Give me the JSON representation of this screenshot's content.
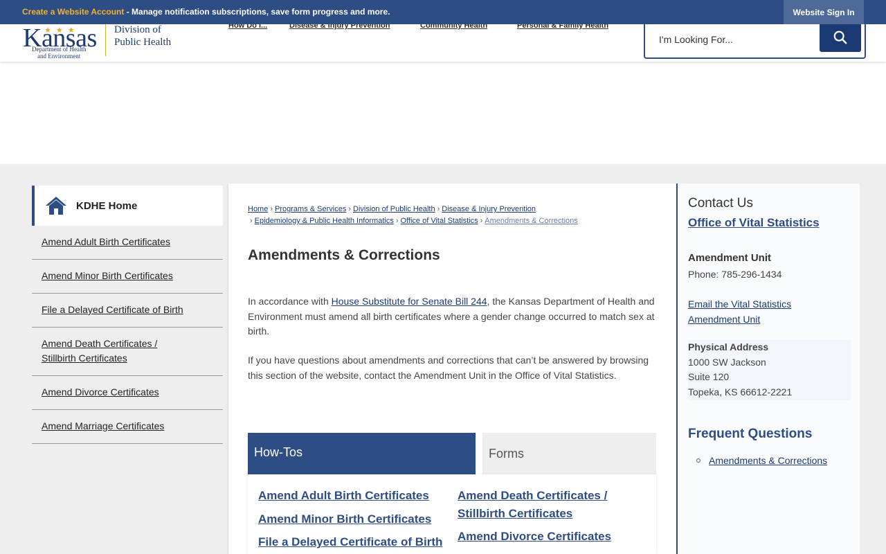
{
  "topbar": {
    "create_label": "Create a Website Account",
    "message": " - Manage notification subscriptions, save form progress and more.",
    "signin_label": "Website Sign In"
  },
  "logo": {
    "kansas": "Kansas",
    "dept_line1": "Department of Health",
    "dept_line2": "and Environment",
    "division_line1": "Division of",
    "division_line2": "Public Health"
  },
  "nav": {
    "items": [
      "How Do I...",
      "Disease & Injury Prevention",
      "Community Health",
      "Personal & Family Health"
    ]
  },
  "search": {
    "placeholder": "I'm Looking For..."
  },
  "sidebar": {
    "home_label": "KDHE Home",
    "items": [
      "Amend Adult Birth Certificates",
      "Amend Minor Birth Certificates",
      "File a Delayed Certificate of Birth",
      "Amend Death Certificates / Stillbirth Certificates",
      "Amend Divorce Certificates",
      "Amend Marriage Certificates"
    ]
  },
  "breadcrumb": {
    "items": [
      "Home",
      "Programs & Services",
      "Division of Public Health",
      "Disease & Injury Prevention",
      "Epidemiology & Public Health Informatics",
      "Office of Vital Statistics"
    ],
    "current": "Amendments & Corrections"
  },
  "main": {
    "title": "Amendments & Corrections",
    "para1_prefix": "In accordance with ",
    "para1_link": "House Substitute for Senate Bill 244",
    "para1_suffix": ", the Kansas Department of Health and Environment must amend all birth certificates where a gender change occurred to match sex at birth.",
    "para2": "If you have questions about amendments and corrections that can’t be answered by browsing this section of the website, contact the Amendment Unit in the Office of Vital Statistics."
  },
  "tabs": {
    "active_label": "How-Tos",
    "inactive_label": "Forms",
    "left_links": [
      "Amend Adult Birth Certificates",
      "Amend Minor Birth Certificates",
      "File a Delayed Certificate of Birth"
    ],
    "right_links": [
      "Amend Death Certificates / Stillbirth Certificates",
      "Amend Divorce Certificates"
    ]
  },
  "rail": {
    "heading": "Contact Us",
    "office": "Office of Vital Statistics",
    "unit": "Amendment Unit",
    "phone": "Phone: 785-296-1434",
    "email": "Email the Vital Statistics Amendment Unit",
    "address_heading": "Physical Address",
    "address_lines": [
      "1000 SW Jackson",
      "Suite 120",
      "Topeka, KS 66612-2221"
    ],
    "faq_heading": "Frequent Questions",
    "faq_item": "Amendments & Corrections"
  },
  "colors": {
    "brand_blue": "#2e4d84",
    "accent_gold": "#f2b22e"
  }
}
